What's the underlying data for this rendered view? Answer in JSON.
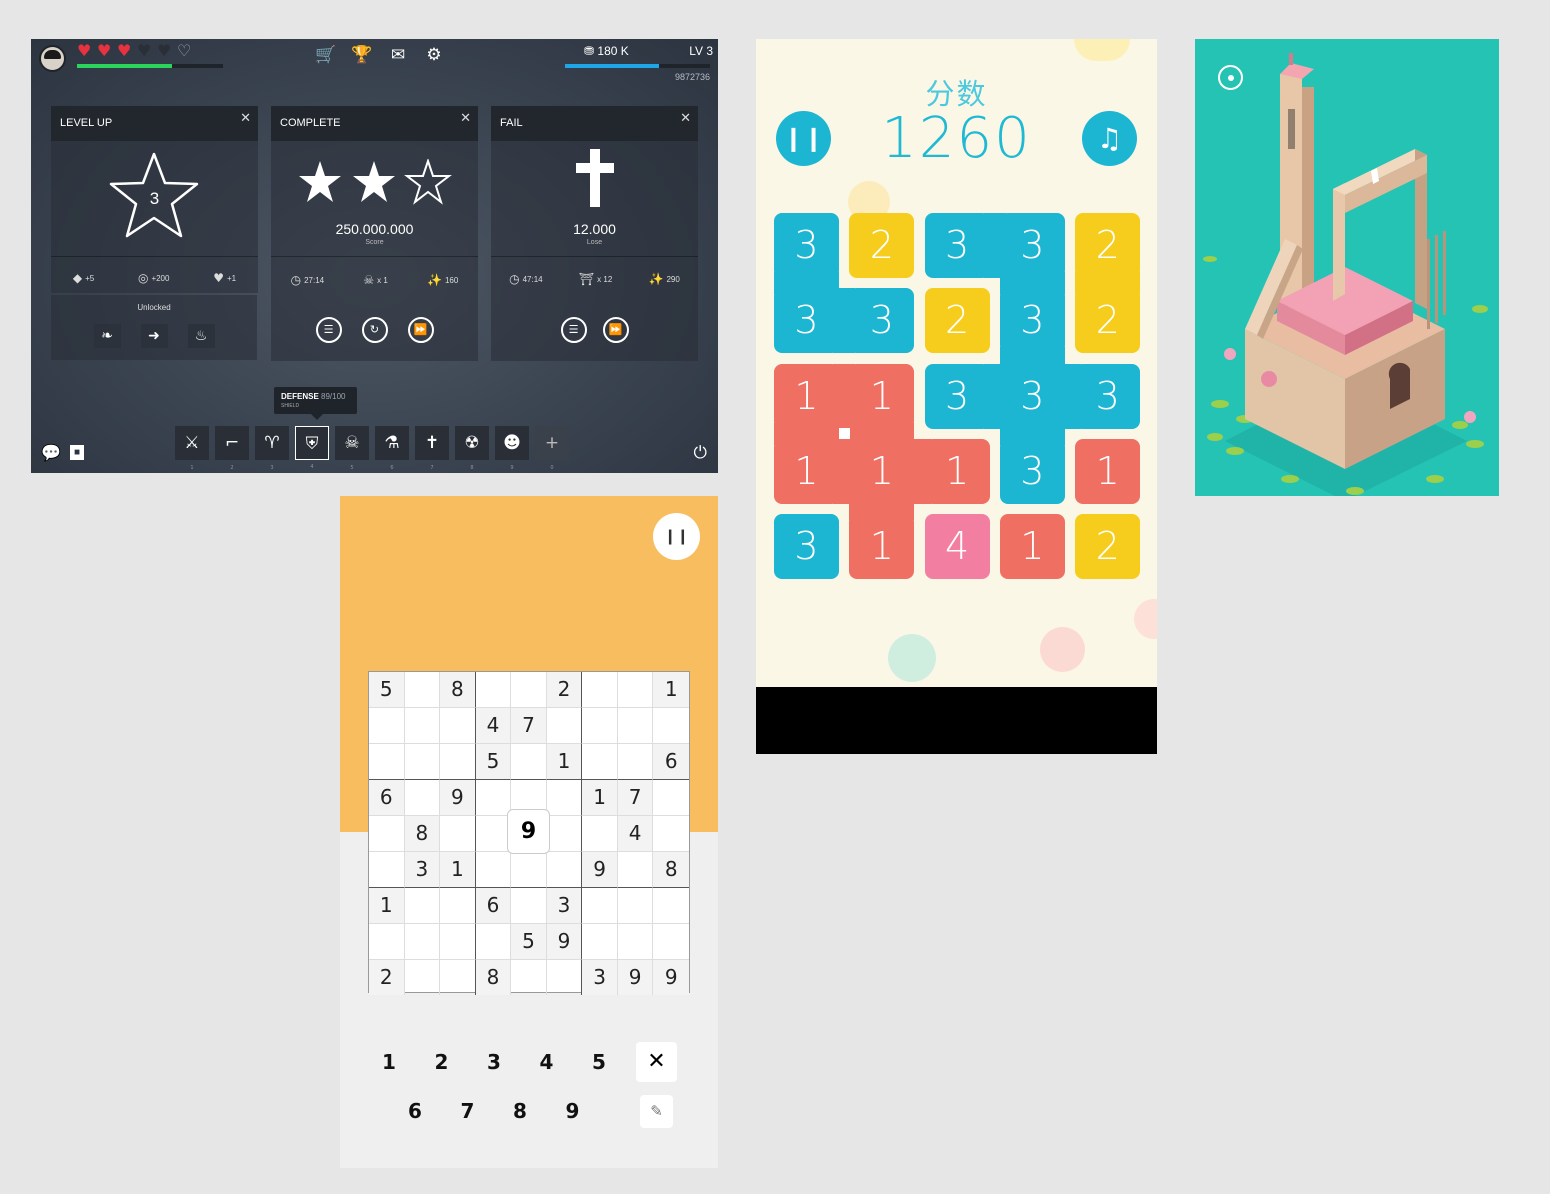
{
  "rpg": {
    "hearts": {
      "full": 3,
      "empty": 3
    },
    "hp_fraction": 0.65,
    "top_icons": [
      "cart-icon",
      "trophy-icon",
      "mail-icon",
      "gear-icon"
    ],
    "coins": "180 K",
    "level": "LV 3",
    "xp_fraction": 0.65,
    "xp_number": "9872736",
    "cards": {
      "level_up": {
        "title": "LEVEL UP",
        "star_number": "3",
        "stats": [
          "+5",
          "+200",
          "+1"
        ],
        "unlocked_label": "Unlocked"
      },
      "complete": {
        "title": "COMPLETE",
        "stars": 3,
        "stars_filled": 2,
        "score": "250.000.000",
        "score_label": "Score",
        "stats": [
          "27:14",
          "x 1",
          "160"
        ]
      },
      "fail": {
        "title": "FAIL",
        "value": "12.000",
        "value_label": "Lose",
        "stats": [
          "47:14",
          "x 12",
          "290"
        ]
      }
    },
    "tooltip": {
      "title": "DEFENSE",
      "value": "89/100",
      "subtitle": "SHIELD"
    },
    "hotbar": [
      {
        "icon": "sword-icon",
        "glyph": "⚔",
        "num": "1"
      },
      {
        "icon": "gun-icon",
        "glyph": "⌐",
        "num": "2"
      },
      {
        "icon": "horned-helmet-icon",
        "glyph": "♈",
        "num": "3"
      },
      {
        "icon": "shield-icon",
        "glyph": "⛨",
        "num": "4",
        "selected": true
      },
      {
        "icon": "skull-icon",
        "glyph": "☠",
        "num": "5"
      },
      {
        "icon": "potion-icon",
        "glyph": "⚗",
        "num": "6"
      },
      {
        "icon": "grave-icon",
        "glyph": "✝",
        "num": "7"
      },
      {
        "icon": "bomb-icon",
        "glyph": "☢",
        "num": "8"
      },
      {
        "icon": "hood-icon",
        "glyph": "☻",
        "num": "9"
      },
      {
        "icon": "add-icon",
        "glyph": "+",
        "num": "0"
      }
    ]
  },
  "number_game": {
    "title": "分数",
    "score": "1260",
    "colors": {
      "cyan": "#1cb6d3",
      "yellow": "#f6cd1c",
      "red": "#f06f63",
      "pink": "#f27fa2"
    },
    "tiles": [
      [
        "3",
        "2",
        "3",
        "3",
        "2"
      ],
      [
        "3",
        "3",
        "2",
        "3",
        "2"
      ],
      [
        "1",
        "1",
        "3",
        "3",
        "3"
      ],
      [
        "1",
        "1",
        "1",
        "3",
        "1"
      ],
      [
        "3",
        "1",
        "4",
        "1",
        "2"
      ]
    ],
    "tile_colors": [
      [
        "cyan",
        "yellow",
        "cyan",
        "cyan",
        "yellow"
      ],
      [
        "cyan",
        "cyan",
        "yellow",
        "cyan",
        "yellow"
      ],
      [
        "red",
        "red",
        "cyan",
        "cyan",
        "cyan"
      ],
      [
        "red",
        "red",
        "red",
        "cyan",
        "red"
      ],
      [
        "cyan",
        "red",
        "pink",
        "red",
        "yellow"
      ]
    ]
  },
  "sudoku": {
    "grid": [
      [
        "5",
        "",
        "8",
        "",
        "",
        "2",
        "",
        "",
        "1"
      ],
      [
        "",
        "",
        "",
        "4",
        "7",
        "",
        "",
        "",
        ""
      ],
      [
        "",
        "",
        "",
        "5",
        "",
        "1",
        "",
        "",
        "6"
      ],
      [
        "6",
        "",
        "9",
        "",
        "",
        "",
        "1",
        "7",
        ""
      ],
      [
        "",
        "8",
        "",
        "",
        "9",
        "",
        "",
        "4",
        ""
      ],
      [
        "",
        "3",
        "1",
        "",
        "",
        "",
        "9",
        "",
        "8"
      ],
      [
        "1",
        "",
        "",
        "6",
        "",
        "3",
        "",
        "",
        ""
      ],
      [
        "",
        "",
        "",
        "",
        "5",
        "9",
        "",
        "",
        ""
      ],
      [
        "2",
        "",
        "",
        "8",
        "",
        "",
        "3",
        "9",
        "9"
      ]
    ],
    "selected_value": "9",
    "keys_row1": [
      "1",
      "2",
      "3",
      "4",
      "5"
    ],
    "keys_row2": [
      "6",
      "7",
      "8",
      "9"
    ],
    "colors": {
      "top": "#f8bd5f"
    }
  }
}
